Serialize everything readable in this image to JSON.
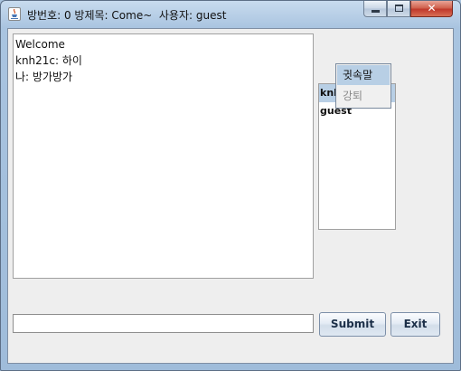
{
  "window": {
    "title": "방번호: 0 방제목: Come~  사용자: guest",
    "app_icon": "java-cup-icon",
    "controls": {
      "minimize": "minimize-icon",
      "maximize": "maximize-icon",
      "close_glyph": "✕"
    }
  },
  "chat": {
    "lines": [
      {
        "text": "Welcome"
      },
      {
        "text": "knh21c: 하이"
      },
      {
        "text": "나: 방가방가"
      }
    ]
  },
  "users": {
    "items": [
      {
        "label": "knh21c (방장)",
        "selected": true
      },
      {
        "label": "guest",
        "selected": false
      }
    ]
  },
  "context_menu": {
    "items": [
      {
        "label": "귓속말",
        "highlighted": true
      },
      {
        "label": "강퇴",
        "highlighted": false
      }
    ]
  },
  "input": {
    "value": "",
    "placeholder": ""
  },
  "buttons": {
    "submit": "Submit",
    "exit": "Exit"
  },
  "colors": {
    "selection": "#b8cfe5",
    "close_button": "#c0392b",
    "button_text": "#1c2f48"
  }
}
